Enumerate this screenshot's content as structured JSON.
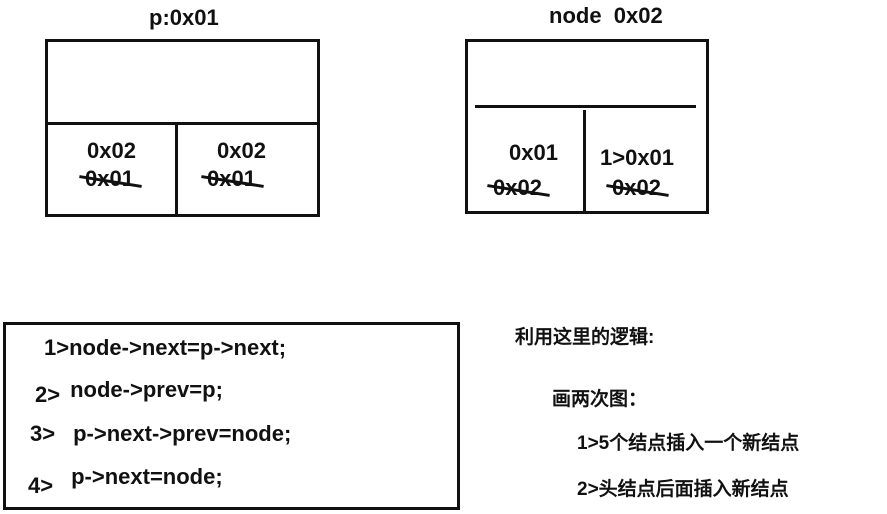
{
  "p_box": {
    "title": "p:0x01",
    "left_cell": {
      "new_value": "0x02",
      "old_value": "0x01"
    },
    "right_cell": {
      "new_value": "0x02",
      "old_value": "0x01"
    }
  },
  "node_box": {
    "title": "node  0x02",
    "left_cell": {
      "new_value": "0x01",
      "old_value": "0x02"
    },
    "right_cell": {
      "new_value": "1>0x01",
      "old_value": "0x02"
    }
  },
  "code_steps": [
    {
      "num": "1>",
      "code": "node->next=p->next;"
    },
    {
      "num": "2>",
      "code": "node->prev=p;"
    },
    {
      "num": "3>",
      "code": "p->next->prev=node;"
    },
    {
      "num": "4>",
      "code": "p->next=node;"
    }
  ],
  "notes": {
    "heading": "利用这里的逻辑:",
    "subheading": "画两次图：",
    "items": [
      "1>5个结点插入一个新结点",
      "2>头结点后面插入新结点"
    ]
  }
}
